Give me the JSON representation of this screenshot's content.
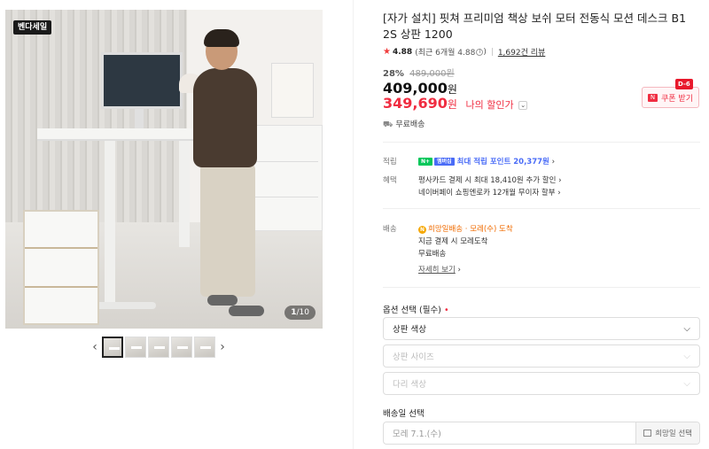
{
  "gallery": {
    "brand_logo": "벤다세일",
    "counter_current": "1",
    "counter_total": "/10",
    "prev_label": "‹",
    "next_label": "›",
    "thumbnail_count": 5
  },
  "product": {
    "title": "[자가 설치] 핏쳐 프리미엄 책상 보쉬 모터 전동식 모션 데스크 B1 2S 상판 1200",
    "rating_score": "4.88",
    "rating_recent": "(최근 6개월 4.88",
    "rating_recent_close": ")",
    "review_count": "1,692건 리뷰",
    "discount_rate": "28%",
    "original_price": "489,000원",
    "price": "409,000",
    "price_unit": "원",
    "my_price": "349,690",
    "my_price_unit": "원",
    "my_price_label": "나의 할인가",
    "shipping": "무료배송",
    "coupon_label": "쿠폰 받기",
    "coupon_dday": "D-6"
  },
  "benefits": {
    "points_label": "적립",
    "points_badge1": "N+",
    "points_badge2": "멤버십",
    "points_text": "최대 적립 포인트 20,377원",
    "benefit_label": "혜택",
    "benefit_line1": "평사카드 결제 시 최대 18,410원 추가 할인",
    "benefit_line2": "네이버페이 쇼핑엔로카 12개월 무이자 할부"
  },
  "delivery": {
    "label": "배송",
    "hope_text": "희망일배송 · 모레(수) 도착",
    "line2": "지금 결제 시 모레도착",
    "line3": "무료배송",
    "detail_link": "자세히 보기"
  },
  "options": {
    "title": "옵션 선택 (필수)",
    "required_mark": "•",
    "selects": [
      {
        "label": "상판 색상"
      },
      {
        "label": "상판 사이즈"
      },
      {
        "label": "다리 색상"
      }
    ]
  },
  "delivery_date": {
    "title": "배송일 선택",
    "value": "모레 7.1.(수)",
    "button": "희망일 선택"
  },
  "colors": {
    "accent_red": "#f02d41",
    "naver_green": "#03c75a",
    "point_blue": "#4a6cf7",
    "hope_orange": "#f06b00"
  }
}
